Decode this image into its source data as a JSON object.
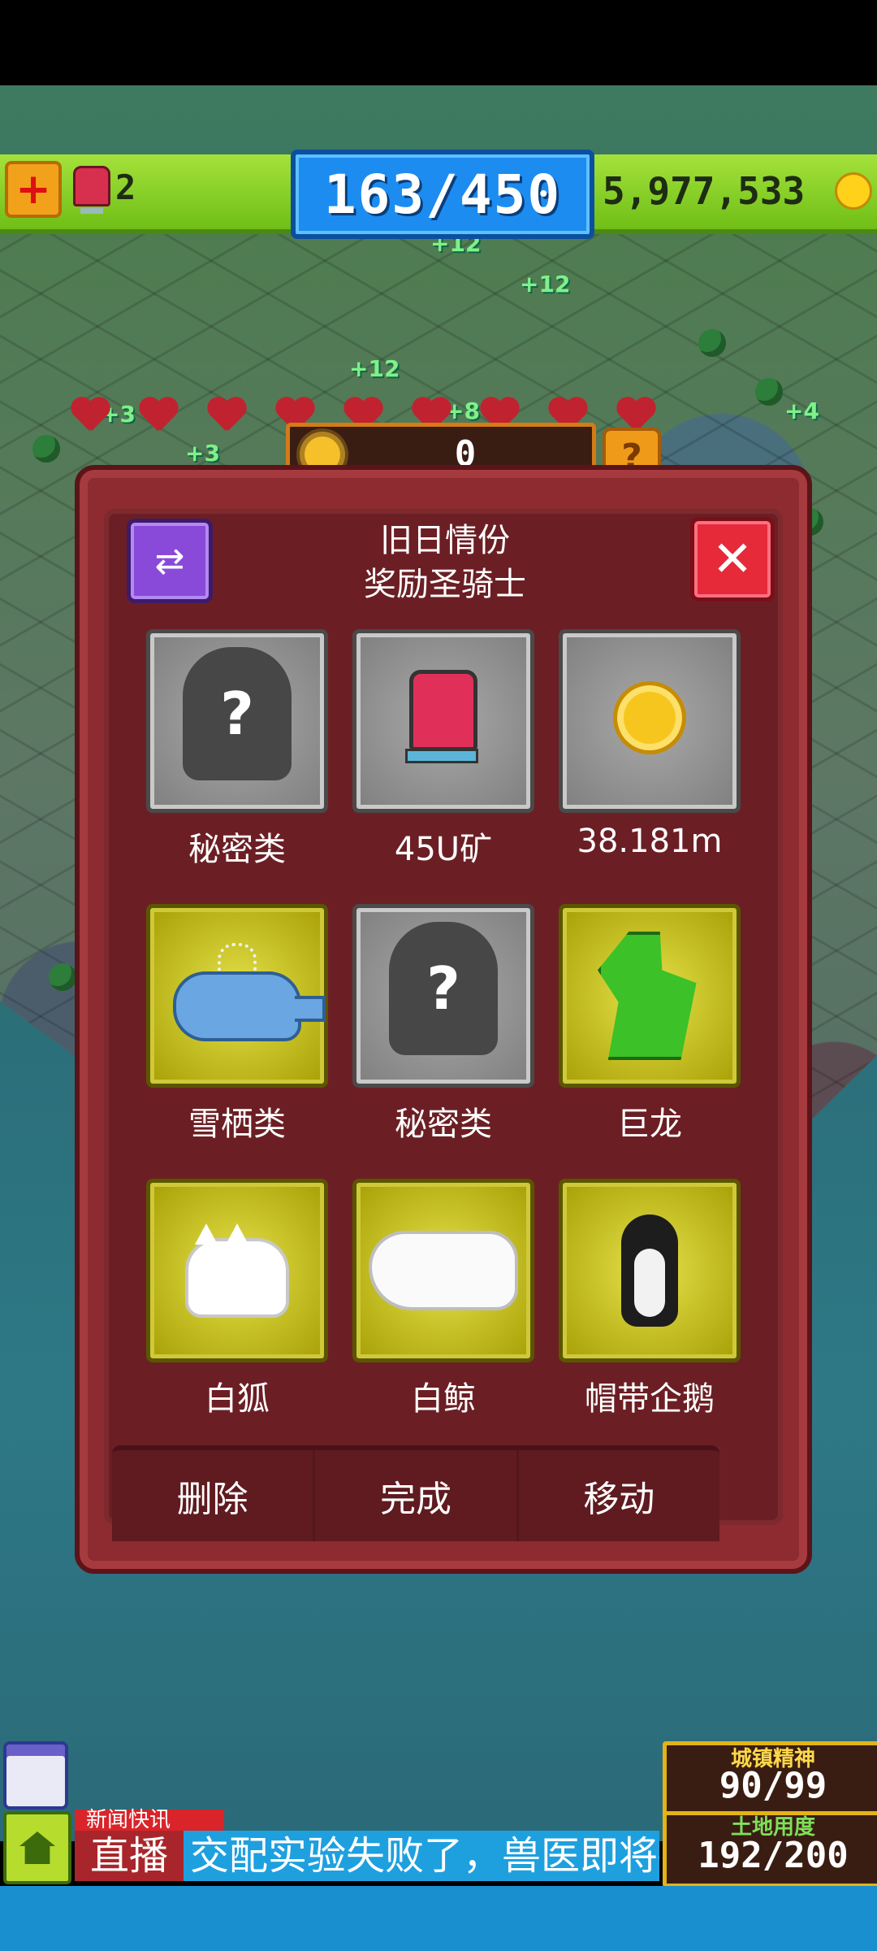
{
  "topbar": {
    "bell_count": "2",
    "population": "163/450",
    "coins": "5,977,533"
  },
  "map_labels": [
    "+12",
    "+12",
    "+12",
    "+3",
    "+3",
    "+4",
    "+8"
  ],
  "dialog": {
    "sun_value": "0",
    "help_label": "?",
    "title_line1": "旧日情份",
    "title_line2": "奖励圣骑士",
    "rewards": [
      {
        "label": "秘密类",
        "icon": "mystery-icon"
      },
      {
        "label": "45U矿",
        "icon": "bell-icon"
      },
      {
        "label": "38.181m",
        "icon": "coin-icon"
      },
      {
        "label": "雪栖类",
        "icon": "whale-icon"
      },
      {
        "label": "秘密类",
        "icon": "mystery-icon"
      },
      {
        "label": "巨龙",
        "icon": "dragon-icon"
      },
      {
        "label": "白狐",
        "icon": "fox-icon"
      },
      {
        "label": "白鲸",
        "icon": "beluga-icon"
      },
      {
        "label": "帽带企鹅",
        "icon": "penguin-icon"
      }
    ],
    "actions": {
      "delete": "删除",
      "complete": "完成",
      "move": "移动"
    }
  },
  "bottom": {
    "news_label": "新闻快讯",
    "live_label": "直播",
    "ticker_text": "交配实验失败了，兽医即将接",
    "spirit_label": "城镇精神",
    "spirit_value": "90/99",
    "land_label": "土地用度",
    "land_value": "192/200"
  }
}
